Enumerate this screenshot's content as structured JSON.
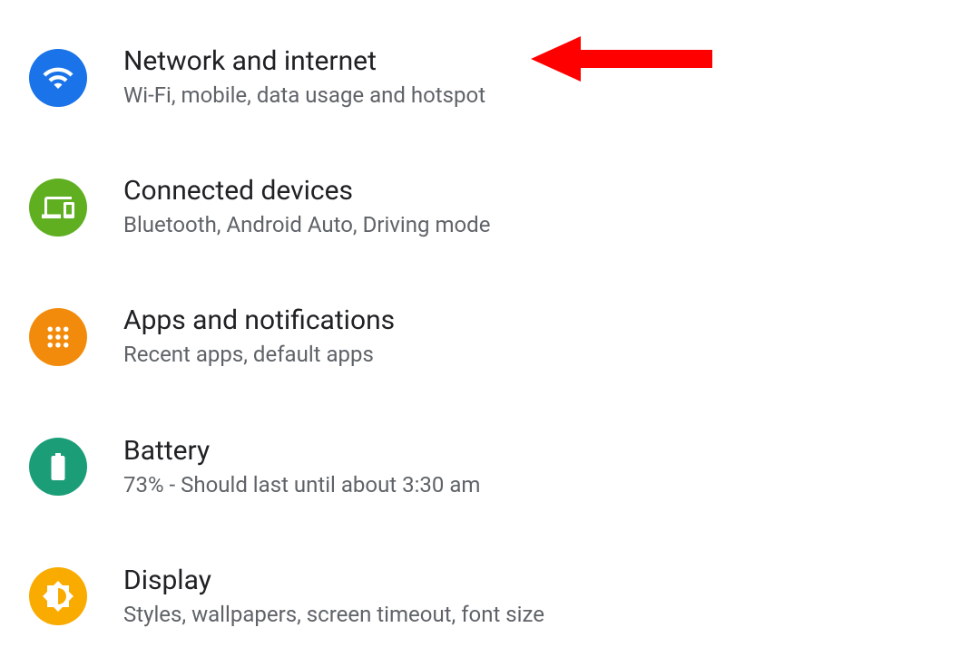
{
  "settings": [
    {
      "id": "network",
      "title": "Network and internet",
      "subtitle": "Wi-Fi, mobile, data usage and hotspot",
      "icon": "wifi-icon",
      "color": "#1a73e8"
    },
    {
      "id": "connected",
      "title": "Connected devices",
      "subtitle": "Bluetooth, Android Auto, Driving mode",
      "icon": "devices-icon",
      "color": "#60af21"
    },
    {
      "id": "apps",
      "title": "Apps and notifications",
      "subtitle": "Recent apps, default apps",
      "icon": "apps-icon",
      "color": "#f28b0c"
    },
    {
      "id": "battery",
      "title": "Battery",
      "subtitle": "73% - Should last until about 3:30 am",
      "icon": "battery-icon",
      "color": "#1b9e77"
    },
    {
      "id": "display",
      "title": "Display",
      "subtitle": "Styles, wallpapers, screen timeout, font size",
      "icon": "brightness-icon",
      "color": "#f9ab00"
    }
  ],
  "annotation": {
    "target": "network",
    "type": "arrow",
    "color": "#ff0000"
  }
}
